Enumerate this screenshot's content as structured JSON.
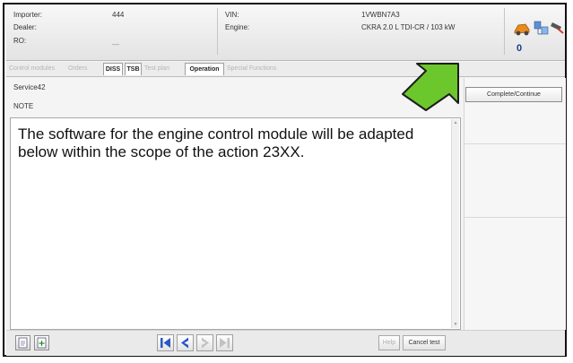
{
  "header": {
    "importer_label": "Importer:",
    "importer_value": "444",
    "dealer_label": "Dealer:",
    "ro_label": "RO:",
    "ro_value": "—",
    "vin_label": "VIN:",
    "vin_value": "1VWBN7A3",
    "engine_label": "Engine:",
    "engine_value": "CKRA 2.0 L TDI-CR / 103 kW",
    "badge_value": "0",
    "icons": [
      "car-icon",
      "network-icon",
      "connector-icon"
    ]
  },
  "tabs": [
    {
      "label": "Control modules",
      "active": false
    },
    {
      "label": "Orders",
      "active": false
    },
    {
      "label": "DISS",
      "active": true
    },
    {
      "label": "TSB",
      "active": true
    },
    {
      "label": "Test plan",
      "active": false
    },
    {
      "label": "Operation",
      "active": true
    },
    {
      "label": "Special Functions",
      "active": false
    }
  ],
  "main": {
    "service_title": "Service42",
    "note_label": "NOTE",
    "message": "The software for the engine control module will be adapted below within the scope of the action 23XX."
  },
  "actions": {
    "complete_continue": "Complete/Continue"
  },
  "bottom": {
    "help_label": "Help",
    "cancel_label": "Cancel test",
    "nav_icons": [
      "first-page-icon",
      "previous-page-icon",
      "next-page-icon",
      "last-page-icon"
    ]
  },
  "colors": {
    "highlight_arrow": "#66c52a",
    "nav_active": "#2b56c4",
    "nav_disabled": "#c2c2c2"
  }
}
